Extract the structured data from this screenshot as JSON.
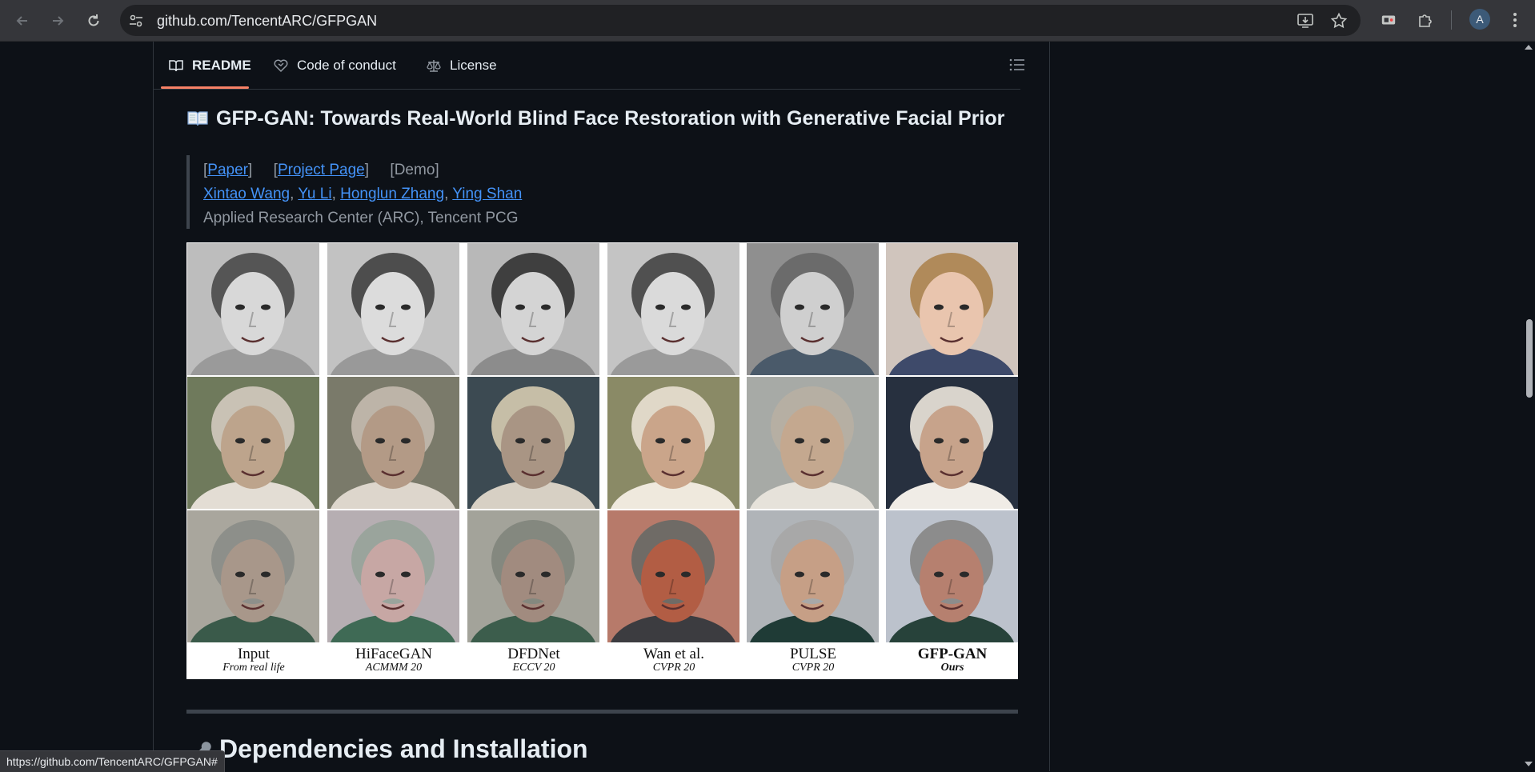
{
  "browser": {
    "url": "github.com/TencentARC/GFPGAN",
    "profile_initial": "A",
    "status_url": "https://github.com/TencentARC/GFPGAN#"
  },
  "tabs": [
    {
      "label": "README",
      "icon": "book-icon",
      "active": true
    },
    {
      "label": "Code of conduct",
      "icon": "heart-handshake-icon",
      "active": false
    },
    {
      "label": "License",
      "icon": "scale-icon",
      "active": false
    }
  ],
  "readme": {
    "title": "GFP-GAN: Towards Real-World Blind Face Restoration with Generative Facial Prior",
    "links": {
      "paper": "Paper",
      "project_page": "Project Page",
      "demo": "[Demo]"
    },
    "authors": [
      "Xintao Wang",
      "Yu Li",
      "Honglun Zhang",
      "Ying Shan"
    ],
    "affiliation": "Applied Research Center (ARC), Tencent PCG",
    "section_heading": "Dependencies and Installation"
  },
  "figure": {
    "columns": [
      {
        "method": "Input",
        "venue": "From real life"
      },
      {
        "method": "HiFaceGAN",
        "venue": "ACMMM 20"
      },
      {
        "method": "DFDNet",
        "venue": "ECCV 20"
      },
      {
        "method": "Wan et al.",
        "venue": "CVPR 20"
      },
      {
        "method": "PULSE",
        "venue": "CVPR 20"
      },
      {
        "method": "GFP-GAN",
        "venue": "Ours"
      }
    ]
  },
  "colors": {
    "page_bg": "#0d1117",
    "link": "#4493f8",
    "tab_underline": "#f78166",
    "muted_text": "#9198a1"
  }
}
